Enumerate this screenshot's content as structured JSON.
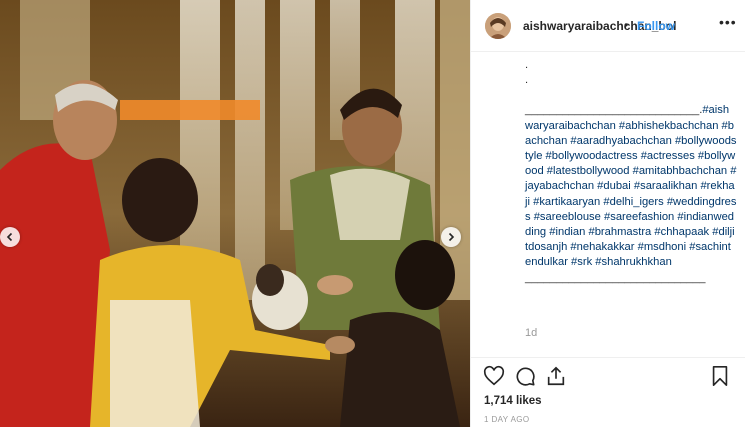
{
  "media": {
    "description_icon": "photo"
  },
  "header": {
    "username": "aishwaryaraibachchan_bol",
    "separator": "•",
    "follow_label": "Follow",
    "more_label": "•••"
  },
  "caption": {
    "dot1": ".",
    "dot2": ".",
    "lead": "____________________________",
    "items": [
      "#aishwaryaraibachchan",
      "#abhishekbachchan",
      "#bachchan",
      "#aaradhyabachchan",
      "#bollywoodstyle",
      "#bollywoodactress",
      "#actresses",
      "#bollywood",
      "#latestbollywood",
      "#amitabhbachchan",
      "#jayabachchan",
      "#dubai",
      "#saraalikhan",
      "#rekhaji",
      "#kartikaaryan",
      "#delhi_igers",
      "#weddingdress",
      "#sareeblouse",
      "#sareefashion",
      "#indianwedding",
      "#indian",
      "#brahmastra",
      "#chhapaak",
      "#diljitdosanjh",
      "#nehakakkar",
      "#msdhoni",
      "#sachintendulkar",
      "#srk",
      "#shahrukhkhan"
    ],
    "trail": "_____________________________"
  },
  "age_short": "1d",
  "likes": "1,714 likes",
  "posted": "1 DAY AGO",
  "colors": {
    "link": "#00376b",
    "follow": "#3897f0",
    "text": "#262626",
    "muted": "#999999"
  },
  "icons": {
    "like": "heart-icon",
    "comment": "comment-icon",
    "share": "share-icon",
    "save": "bookmark-icon"
  }
}
